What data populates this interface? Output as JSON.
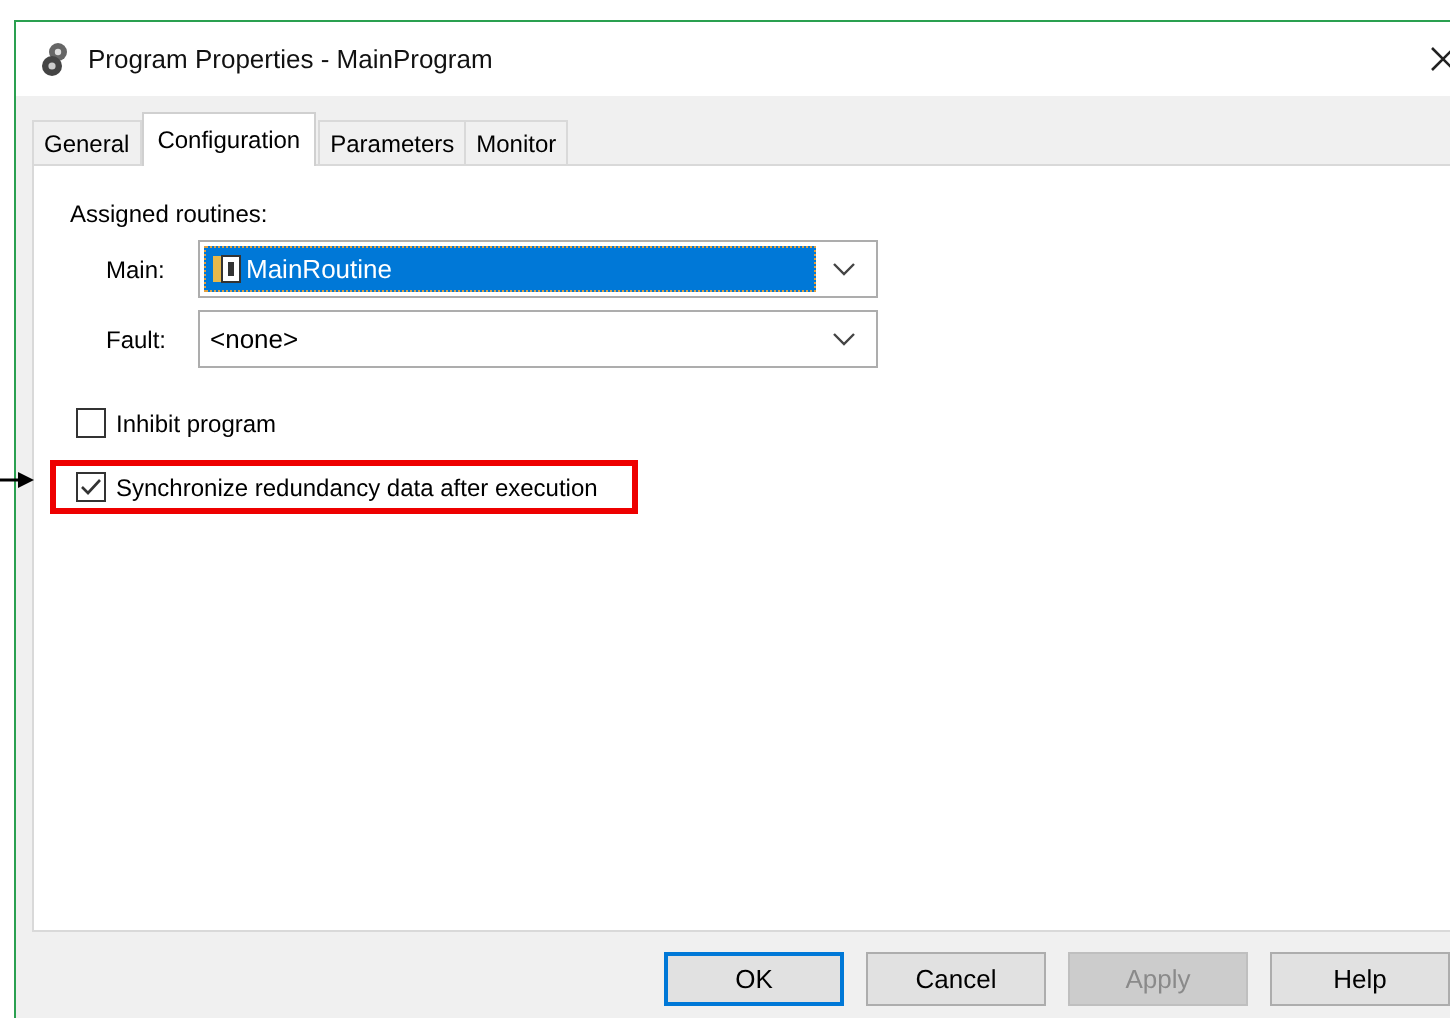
{
  "window": {
    "title": "Program Properties - MainProgram"
  },
  "tabs": [
    {
      "label": "General",
      "selected": false
    },
    {
      "label": "Configuration",
      "selected": true
    },
    {
      "label": "Parameters",
      "selected": false
    },
    {
      "label": "Monitor",
      "selected": false
    }
  ],
  "group_label": "Assigned routines:",
  "routines": [
    {
      "label": "Main:",
      "value": "MainRoutine",
      "focused": true,
      "has_icon": true
    },
    {
      "label": "Fault:",
      "value": "<none>",
      "focused": false,
      "has_icon": false
    }
  ],
  "options": [
    {
      "label": "Inhibit program",
      "checked": false,
      "highlighted": false
    },
    {
      "label": "Synchronize redundancy data after execution",
      "checked": true,
      "highlighted": true
    }
  ],
  "buttons": [
    {
      "label": "OK",
      "default": true,
      "disabled": false
    },
    {
      "label": "Cancel",
      "default": false,
      "disabled": false
    },
    {
      "label": "Apply",
      "default": false,
      "disabled": true
    },
    {
      "label": "Help",
      "default": false,
      "disabled": false
    }
  ]
}
